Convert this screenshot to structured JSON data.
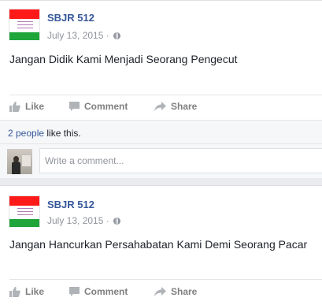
{
  "posts": [
    {
      "author": "SBJR 512",
      "date": "July 13, 2015",
      "separator": "·",
      "text": "Jangan Didik Kami Menjadi Seorang Pengecut",
      "actions": {
        "like": "Like",
        "comment": "Comment",
        "share": "Share"
      },
      "likes": {
        "count_link": "2 people",
        "suffix": " like this."
      },
      "comment_placeholder": "Write a comment..."
    },
    {
      "author": "SBJR 512",
      "date": "July 13, 2015",
      "separator": "·",
      "text": "Jangan Hancurkan Persahabatan Kami Demi Seorang Pacar",
      "actions": {
        "like": "Like",
        "comment": "Comment",
        "share": "Share"
      }
    }
  ],
  "icons": {
    "avatar": "red-white-green-flag-icon",
    "privacy": "globe-icon",
    "like": "thumbs-up-icon",
    "comment": "speech-bubble-icon",
    "share": "share-arrow-icon"
  },
  "colors": {
    "link": "#365899",
    "muted": "#90949c",
    "action": "#7f7f7f",
    "background": "#e9ebee"
  }
}
